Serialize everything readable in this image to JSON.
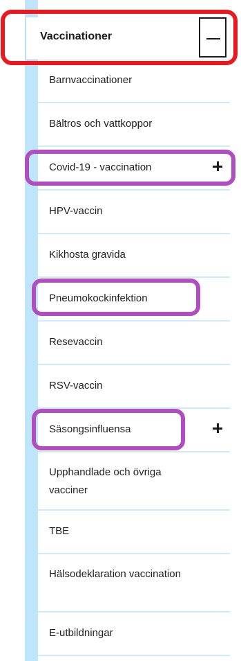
{
  "menu": {
    "header_label": "Vaccinationer",
    "collapse_icon": "minus-icon",
    "items": [
      {
        "label": "Barnvaccinationer",
        "expandable": false
      },
      {
        "label": "Bältros och vattkoppor",
        "expandable": false
      },
      {
        "label": "Covid-19 - vaccination",
        "expandable": true,
        "icon": "plus-icon"
      },
      {
        "label": "HPV-vaccin",
        "expandable": false
      },
      {
        "label": "Kikhosta gravida",
        "expandable": false
      },
      {
        "label": "Pneumokockinfektion",
        "expandable": false
      },
      {
        "label": "Resevaccin",
        "expandable": false
      },
      {
        "label": "RSV-vaccin",
        "expandable": false
      },
      {
        "label": "Säsongsinfluensa",
        "expandable": true,
        "icon": "plus-icon"
      },
      {
        "label": "Upphandlade och övriga vacciner",
        "expandable": false
      },
      {
        "label": "TBE",
        "expandable": false
      },
      {
        "label": "Hälsodeklaration vaccination",
        "expandable": false
      },
      {
        "label": "E-utbildningar",
        "expandable": false
      }
    ]
  },
  "colors": {
    "rail": "#bfe5fb",
    "divider": "#cdeafa",
    "header_highlight": "#e8191f",
    "item_highlight": "#b04ec1"
  }
}
